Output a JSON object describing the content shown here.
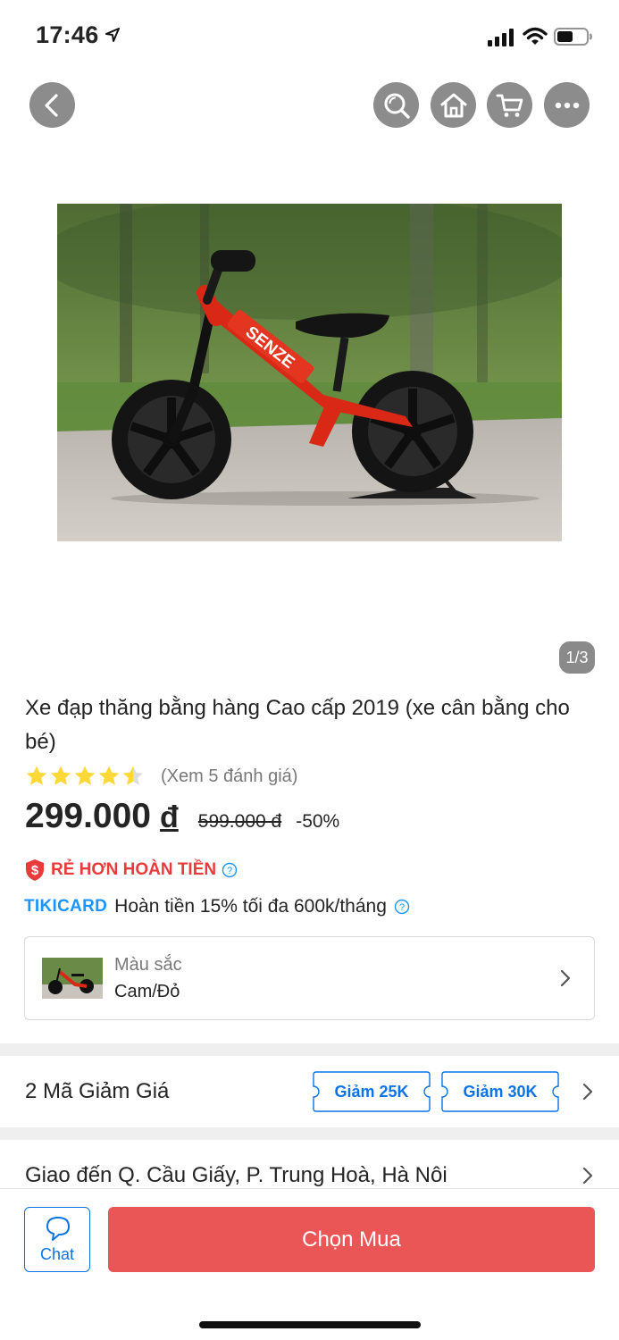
{
  "status_bar": {
    "time": "17:46"
  },
  "product": {
    "title": "Xe đạp thăng bằng hàng Cao cấp 2019 (xe cân bằng cho bé)",
    "image_counter": "1/3",
    "rating": 4.5,
    "rating_max": 5,
    "review_link": "(Xem 5 đánh giá)",
    "price": "299.000",
    "currency": "đ",
    "list_price": "599.000 đ",
    "discount": "-50%",
    "bike_brand_mark": "SENZE"
  },
  "promo": {
    "cashback_label": "RẺ HƠN HOÀN TIỀN",
    "tikicard_logo": "TIKICARD",
    "tikicard_text": "Hoàn tiền 15% tối đa 600k/tháng"
  },
  "variant": {
    "label": "Màu sắc",
    "value": "Cam/Đỏ"
  },
  "coupons": {
    "title": "2 Mã Giảm Giá",
    "items": [
      "Giảm 25K",
      "Giảm 30K"
    ]
  },
  "delivery": {
    "text": "Giao đến Q. Cầu Giấy, P. Trung Hoà, Hà Nôi"
  },
  "bottom_bar": {
    "chat_label": "Chat",
    "buy_label": "Chọn Mua"
  },
  "colors": {
    "price_red": "#e83b3b",
    "buy_button": "#ea5555",
    "link_blue": "#0b74e5",
    "tiki_blue": "#1a94ff",
    "star_yellow": "#fdd836"
  },
  "icons": [
    "back-icon",
    "search-icon",
    "home-icon",
    "cart-icon",
    "more-icon",
    "shield-dollar-icon",
    "help-icon",
    "chevron-right-icon",
    "chat-bubble-icon"
  ]
}
